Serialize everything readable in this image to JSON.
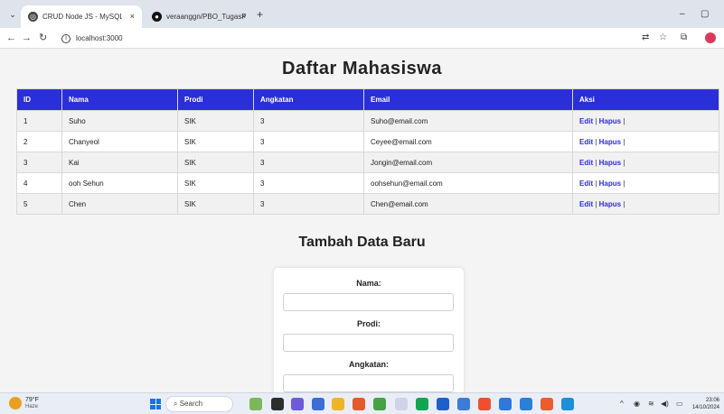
{
  "browser": {
    "tabs": [
      {
        "label": "CRUD Node JS - MySQL"
      },
      {
        "label": "veraanggn/PBO_TugasPert6"
      }
    ],
    "new_tab_glyph": "+",
    "close_glyph": "×",
    "window_controls": {
      "minimize": "–",
      "maximize": "▢"
    },
    "address": "localhost:3000"
  },
  "page": {
    "title": "Daftar Mahasiswa",
    "table": {
      "headers": [
        "ID",
        "Nama",
        "Prodi",
        "Angkatan",
        "Email",
        "Aksi"
      ],
      "rows": [
        {
          "id": "1",
          "nama": "Suho",
          "prodi": "SIK",
          "angkatan": "3",
          "email": "Suho@email.com"
        },
        {
          "id": "2",
          "nama": "Chanyeol",
          "prodi": "SIK",
          "angkatan": "3",
          "email": "Ceyee@email.com"
        },
        {
          "id": "3",
          "nama": "Kai",
          "prodi": "SIK",
          "angkatan": "3",
          "email": "Jongin@email.com"
        },
        {
          "id": "4",
          "nama": "ooh Sehun",
          "prodi": "SIK",
          "angkatan": "3",
          "email": "oohsehun@email.com"
        },
        {
          "id": "5",
          "nama": "Chen",
          "prodi": "SIK",
          "angkatan": "3",
          "email": "Chen@email.com"
        }
      ],
      "edit_label": "Edit",
      "hapus_label": "Hapus",
      "separator": "|"
    },
    "form": {
      "title": "Tambah Data Baru",
      "nama_label": "Nama:",
      "prodi_label": "Prodi:",
      "angkatan_label": "Angkatan:",
      "nama_value": "",
      "prodi_value": "",
      "angkatan_value": ""
    }
  },
  "taskbar": {
    "weather_temp": "79°F",
    "weather_cond": "Haze",
    "search_placeholder": "Search",
    "time": "23:06",
    "date": "14/10/2024"
  },
  "colors": {
    "accent": "#2b2fd9",
    "row_alt": "#f1f1f1"
  }
}
